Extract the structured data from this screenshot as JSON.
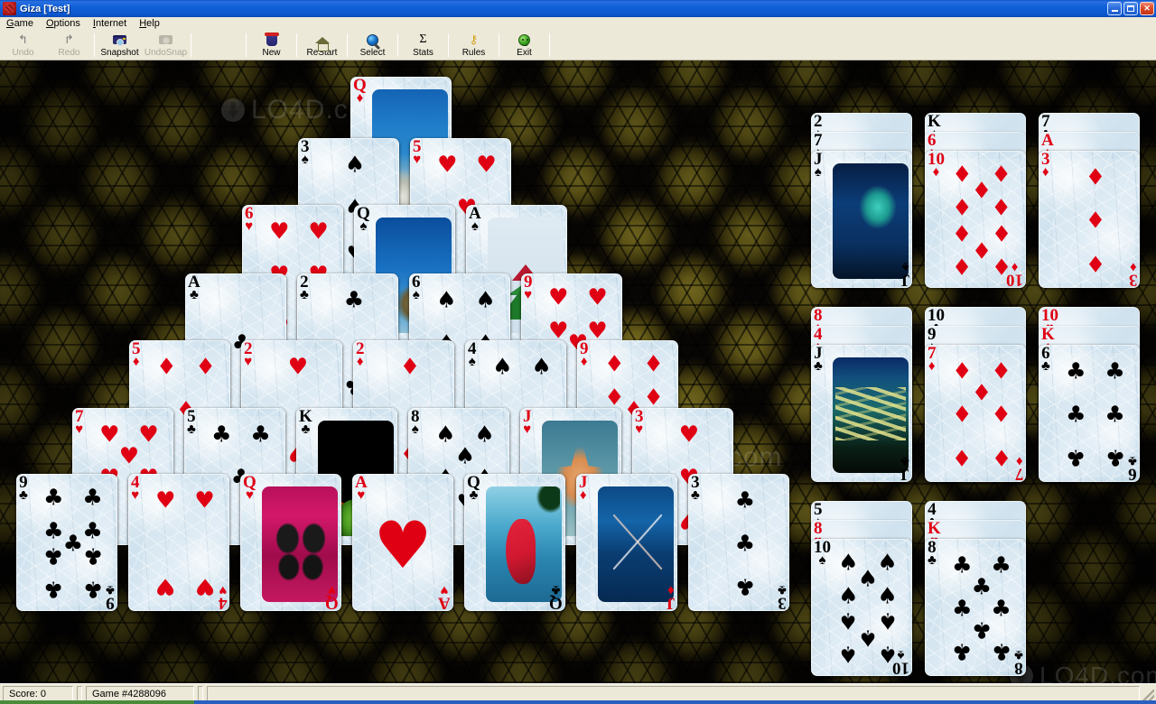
{
  "window": {
    "title": "Giza [Test]",
    "icon": "app-icon",
    "buttons": {
      "minimize": "–",
      "maximize": "❐",
      "close": "✕"
    }
  },
  "menubar": {
    "items": [
      {
        "label": "Game",
        "accel": "G"
      },
      {
        "label": "Options",
        "accel": "O"
      },
      {
        "label": "Internet",
        "accel": "I"
      },
      {
        "label": "Help",
        "accel": "H"
      }
    ]
  },
  "toolbar": {
    "buttons": [
      {
        "label": "Undo",
        "icon": "undo-icon",
        "enabled": false
      },
      {
        "label": "Redo",
        "icon": "redo-icon",
        "enabled": false
      },
      {
        "label": "Snapshot",
        "icon": "camera-icon",
        "enabled": true
      },
      {
        "label": "UndoSnap",
        "icon": "camera-lock-icon",
        "enabled": false
      },
      {
        "label": "New",
        "icon": "trash-new-icon",
        "enabled": true
      },
      {
        "label": "ReStart",
        "icon": "home-icon",
        "enabled": true
      },
      {
        "label": "Select",
        "icon": "globe-search-icon",
        "enabled": true
      },
      {
        "label": "Stats",
        "icon": "sigma-icon",
        "enabled": true
      },
      {
        "label": "Rules",
        "icon": "key-icon",
        "enabled": true
      },
      {
        "label": "Exit",
        "icon": "smiley-exit-icon",
        "enabled": true
      }
    ]
  },
  "statusbar": {
    "score_label": "Score:  0",
    "game_label": "Game #4288096",
    "extra": ""
  },
  "watermarks": [
    {
      "text": "LO4D.com",
      "logo": true
    },
    {
      "text": "LO4D.com",
      "logo": false
    },
    {
      "text": "LO4D.com",
      "logo": true
    }
  ],
  "colors": {
    "red": "#e00014",
    "black": "#000000",
    "title_bar": "#0c55cc",
    "chrome": "#ece9d8",
    "felt": "#0a0806"
  },
  "tableau": {
    "rows": [
      [
        {
          "rank": "Q",
          "suit": "♦",
          "color": "red",
          "face": "picture",
          "art": "coral"
        }
      ],
      [
        {
          "rank": "3",
          "suit": "♠",
          "color": "black",
          "face": "pips"
        },
        {
          "rank": "5",
          "suit": "♥",
          "color": "red",
          "face": "pips"
        }
      ],
      [
        {
          "rank": "6",
          "suit": "♥",
          "color": "red",
          "face": "pips"
        },
        {
          "rank": "Q",
          "suit": "♠",
          "color": "black",
          "face": "picture",
          "art": "turtle"
        },
        {
          "rank": "A",
          "suit": "♠",
          "color": "black",
          "face": "picture",
          "art": "pyramid"
        }
      ],
      [
        {
          "rank": "A",
          "suit": "♣",
          "color": "black",
          "face": "pips"
        },
        {
          "rank": "2",
          "suit": "♣",
          "color": "black",
          "face": "pips"
        },
        {
          "rank": "6",
          "suit": "♠",
          "color": "black",
          "face": "pips"
        },
        {
          "rank": "9",
          "suit": "♥",
          "color": "red",
          "face": "pips"
        }
      ],
      [
        {
          "rank": "5",
          "suit": "♦",
          "color": "red",
          "face": "pips"
        },
        {
          "rank": "2",
          "suit": "♥",
          "color": "red",
          "face": "pips"
        },
        {
          "rank": "2",
          "suit": "♦",
          "color": "red",
          "face": "pips"
        },
        {
          "rank": "4",
          "suit": "♠",
          "color": "black",
          "face": "pips"
        },
        {
          "rank": "9",
          "suit": "♦",
          "color": "red",
          "face": "pips"
        }
      ],
      [
        {
          "rank": "7",
          "suit": "♥",
          "color": "red",
          "face": "pips"
        },
        {
          "rank": "5",
          "suit": "♣",
          "color": "black",
          "face": "pips"
        },
        {
          "rank": "K",
          "suit": "♣",
          "color": "black",
          "face": "picture",
          "art": "frog"
        },
        {
          "rank": "8",
          "suit": "♠",
          "color": "black",
          "face": "pips"
        },
        {
          "rank": "J",
          "suit": "♥",
          "color": "red",
          "face": "picture",
          "art": "starfish"
        },
        {
          "rank": "3",
          "suit": "♥",
          "color": "red",
          "face": "pips"
        }
      ],
      [
        {
          "rank": "9",
          "suit": "♣",
          "color": "black",
          "face": "pips"
        },
        {
          "rank": "4",
          "suit": "♥",
          "color": "red",
          "face": "pips"
        },
        {
          "rank": "Q",
          "suit": "♥",
          "color": "red",
          "face": "picture",
          "art": "butterfly"
        },
        {
          "rank": "A",
          "suit": "♥",
          "color": "red",
          "face": "bigpip"
        },
        {
          "rank": "Q",
          "suit": "♣",
          "color": "black",
          "face": "picture",
          "art": "parrot"
        },
        {
          "rank": "J",
          "suit": "♦",
          "color": "red",
          "face": "picture",
          "art": "boats"
        },
        {
          "rank": "3",
          "suit": "♣",
          "color": "black",
          "face": "pips"
        }
      ]
    ]
  },
  "reserves": {
    "piles": [
      {
        "hidden": [
          {
            "rank": "2",
            "suit": "♠",
            "color": "black"
          },
          {
            "rank": "7",
            "suit": "♠",
            "color": "black"
          }
        ],
        "top": {
          "rank": "J",
          "suit": "♠",
          "color": "black",
          "face": "picture",
          "art": "fish"
        }
      },
      {
        "hidden": [
          {
            "rank": "K",
            "suit": "♠",
            "color": "black"
          },
          {
            "rank": "6",
            "suit": "♦",
            "color": "red"
          }
        ],
        "top": {
          "rank": "10",
          "suit": "♦",
          "color": "red",
          "face": "pips"
        }
      },
      {
        "hidden": [
          {
            "rank": "7",
            "suit": "♣",
            "color": "black"
          },
          {
            "rank": "A",
            "suit": "♦",
            "color": "red"
          }
        ],
        "top": {
          "rank": "3",
          "suit": "♦",
          "color": "red",
          "face": "pips"
        }
      },
      {
        "hidden": [
          {
            "rank": "8",
            "suit": "♦",
            "color": "red"
          },
          {
            "rank": "4",
            "suit": "♦",
            "color": "red"
          }
        ],
        "top": {
          "rank": "J",
          "suit": "♣",
          "color": "black",
          "face": "picture",
          "art": "school"
        }
      },
      {
        "hidden": [
          {
            "rank": "10",
            "suit": "♣",
            "color": "black"
          },
          {
            "rank": "9",
            "suit": "♠",
            "color": "black"
          }
        ],
        "top": {
          "rank": "7",
          "suit": "♦",
          "color": "red",
          "face": "pips"
        }
      },
      {
        "hidden": [
          {
            "rank": "10",
            "suit": "♥",
            "color": "red"
          },
          {
            "rank": "K",
            "suit": "♦",
            "color": "red"
          }
        ],
        "top": {
          "rank": "6",
          "suit": "♣",
          "color": "black",
          "face": "pips"
        }
      },
      {
        "hidden": [
          {
            "rank": "5",
            "suit": "♠",
            "color": "black"
          },
          {
            "rank": "8",
            "suit": "♥",
            "color": "red"
          }
        ],
        "top": {
          "rank": "10",
          "suit": "♠",
          "color": "black",
          "face": "pips"
        }
      },
      {
        "hidden": [
          {
            "rank": "4",
            "suit": "♣",
            "color": "black"
          },
          {
            "rank": "K",
            "suit": "♥",
            "color": "red"
          }
        ],
        "top": {
          "rank": "8",
          "suit": "♣",
          "color": "black",
          "face": "pips"
        }
      }
    ]
  }
}
